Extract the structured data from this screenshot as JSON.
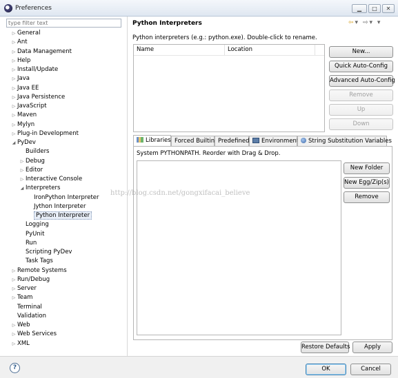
{
  "window": {
    "title": "Preferences",
    "min_glyph": "▁",
    "max_glyph": "□",
    "close_glyph": "✕"
  },
  "filter": {
    "placeholder": "type filter text"
  },
  "tree": [
    {
      "label": "General",
      "arrow": "▷"
    },
    {
      "label": "Ant",
      "arrow": "▷"
    },
    {
      "label": "Data Management",
      "arrow": "▷"
    },
    {
      "label": "Help",
      "arrow": "▷"
    },
    {
      "label": "Install/Update",
      "arrow": "▷"
    },
    {
      "label": "Java",
      "arrow": "▷"
    },
    {
      "label": "Java EE",
      "arrow": "▷"
    },
    {
      "label": "Java Persistence",
      "arrow": "▷"
    },
    {
      "label": "JavaScript",
      "arrow": "▷"
    },
    {
      "label": "Maven",
      "arrow": "▷"
    },
    {
      "label": "Mylyn",
      "arrow": "▷"
    },
    {
      "label": "Plug-in Development",
      "arrow": "▷"
    },
    {
      "label": "PyDev",
      "arrow": "◢"
    },
    {
      "label": "Builders",
      "arrow": ""
    },
    {
      "label": "Debug",
      "arrow": "▷"
    },
    {
      "label": "Editor",
      "arrow": "▷"
    },
    {
      "label": "Interactive Console",
      "arrow": "▷"
    },
    {
      "label": "Interpreters",
      "arrow": "◢"
    },
    {
      "label": "IronPython Interpreter",
      "arrow": ""
    },
    {
      "label": "Jython Interpreter",
      "arrow": ""
    },
    {
      "label": "Python Interpreter",
      "arrow": ""
    },
    {
      "label": "Logging",
      "arrow": ""
    },
    {
      "label": "PyUnit",
      "arrow": ""
    },
    {
      "label": "Run",
      "arrow": ""
    },
    {
      "label": "Scripting PyDev",
      "arrow": ""
    },
    {
      "label": "Task Tags",
      "arrow": ""
    },
    {
      "label": "Remote Systems",
      "arrow": "▷"
    },
    {
      "label": "Run/Debug",
      "arrow": "▷"
    },
    {
      "label": "Server",
      "arrow": "▷"
    },
    {
      "label": "Team",
      "arrow": "▷"
    },
    {
      "label": "Terminal",
      "arrow": ""
    },
    {
      "label": "Validation",
      "arrow": ""
    },
    {
      "label": "Web",
      "arrow": "▷"
    },
    {
      "label": "Web Services",
      "arrow": "▷"
    },
    {
      "label": "XML",
      "arrow": "▷"
    }
  ],
  "page": {
    "title": "Python Interpreters",
    "back_glyph": "⇦",
    "forward_glyph": "⇨",
    "menu_glyph": "▾",
    "description": "Python interpreters (e.g.: python.exe).   Double-click to rename.",
    "columns": [
      "Name",
      "Location"
    ],
    "buttons": {
      "new": "New...",
      "quick_auto_config": "Quick Auto-Config",
      "advanced_auto_config": "Advanced Auto-Config",
      "remove": "Remove",
      "up": "Up",
      "down": "Down"
    },
    "tabs": [
      "Libraries",
      "Forced Builtins",
      "Predefined",
      "Environment",
      "String Substitution Variables"
    ],
    "tab_description": "System PYTHONPATH.   Reorder with Drag & Drop.",
    "lib_buttons": {
      "new_folder": "New Folder",
      "new_egg": "New Egg/Zip(s)",
      "remove": "Remove"
    },
    "watermark": "http://blog.csdn.net/gongxifacai_believe"
  },
  "footer": {
    "restore_defaults": "Restore Defaults",
    "apply": "Apply",
    "ok": "OK",
    "cancel": "Cancel",
    "help_glyph": "?"
  }
}
